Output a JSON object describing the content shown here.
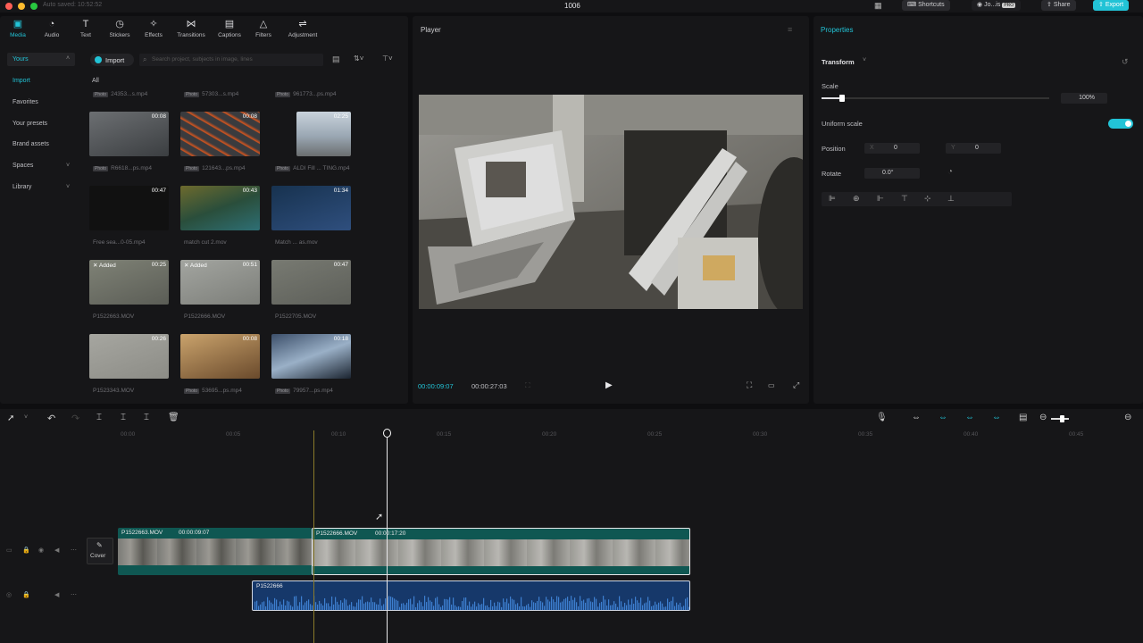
{
  "topbar": {
    "status": "Auto saved: 10:52:52",
    "project": "1006",
    "shortcuts": "Shortcuts",
    "user": "Jo...is",
    "pro": "PRO",
    "share": "Share",
    "export": "Export"
  },
  "toolbar": [
    {
      "label": "Media",
      "icon": "media-icon"
    },
    {
      "label": "Audio",
      "icon": "audio-icon"
    },
    {
      "label": "Text",
      "icon": "text-icon"
    },
    {
      "label": "Stickers",
      "icon": "stickers-icon"
    },
    {
      "label": "Effects",
      "icon": "effects-icon"
    },
    {
      "label": "Transitions",
      "icon": "transitions-icon"
    },
    {
      "label": "Captions",
      "icon": "captions-icon"
    },
    {
      "label": "Filters",
      "icon": "filters-icon"
    },
    {
      "label": "Adjustment",
      "icon": "adjustment-icon"
    }
  ],
  "sidebar": {
    "yours": "Yours",
    "import": "Import",
    "favorites": "Favorites",
    "presets": "Your presets",
    "brand": "Brand assets",
    "spaces": "Spaces",
    "library": "Library"
  },
  "media": {
    "import_button": "Import",
    "search_placeholder": "Search project, subjects in image, lines",
    "all": "All",
    "top_names": [
      "24353...s.mp4",
      "57303...s.mp4",
      "961773...ps.mp4"
    ],
    "items": [
      {
        "name": "R6618...ps.mp4",
        "duration": "00:08",
        "tag": ""
      },
      {
        "name": "121643...ps.mp4",
        "duration": "00:08",
        "tag": ""
      },
      {
        "name": "ALDI Fill ... TING.mp4",
        "duration": "02:25",
        "tag": ""
      },
      {
        "name": "Free sea...0-05.mp4",
        "duration": "00:47",
        "tag": ""
      },
      {
        "name": "match cut 2.mov",
        "duration": "00:43",
        "tag": ""
      },
      {
        "name": "Match ... as.mov",
        "duration": "01:34",
        "tag": ""
      },
      {
        "name": "P1522663.MOV",
        "duration": "00:25",
        "tag": "Added"
      },
      {
        "name": "P1522666.MOV",
        "duration": "00:51",
        "tag": "Added"
      },
      {
        "name": "P1522705.MOV",
        "duration": "00:47",
        "tag": ""
      },
      {
        "name": "P1523343.MOV",
        "duration": "00:26",
        "tag": ""
      },
      {
        "name": "53695...ps.mp4",
        "duration": "00:08",
        "tag": ""
      },
      {
        "name": "79957...ps.mp4",
        "duration": "00:18",
        "tag": ""
      }
    ]
  },
  "player": {
    "title": "Player",
    "current_time": "00:00:09:07",
    "total_time": "00:00:27:03"
  },
  "properties": {
    "title": "Properties",
    "section": "Transform",
    "scale_label": "Scale",
    "scale_value": "100%",
    "scale_fraction": 0.09,
    "uniform_label": "Uniform scale",
    "uniform_on": true,
    "position_label": "Position",
    "x_label": "X",
    "x_value": "0",
    "y_label": "Y",
    "y_value": "0",
    "rotate_label": "Rotate",
    "rotate_value": "0.0°"
  },
  "timeline": {
    "ruler": [
      "00:00",
      "00:05",
      "00:10",
      "00:15",
      "00:20",
      "00:25",
      "00:30",
      "00:35",
      "00:40",
      "00:45"
    ],
    "cover_label": "Cover",
    "clip1": {
      "name": "P1522663.MOV",
      "duration": "00:00:09:07"
    },
    "clip2": {
      "name": "P1522666.MOV",
      "duration": "00:00:17:20"
    },
    "audio": {
      "name": "P1522666"
    }
  }
}
